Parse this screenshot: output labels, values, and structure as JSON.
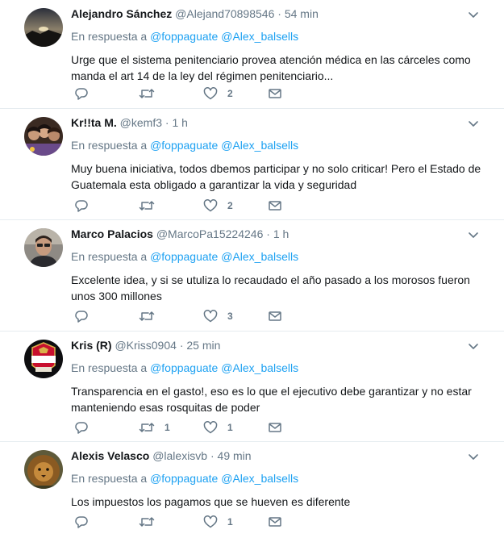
{
  "reply_prefix": "En respuesta a",
  "mentions": [
    "@foppaguate",
    "@Alex_balsells"
  ],
  "tweets": [
    {
      "name": "Alejandro Sánchez",
      "handle": "@Alejand70898546",
      "time": "54 min",
      "text": "Urge que el sistema penitenciario provea atención médica en las cárceles como manda el art 14 de la ley del régimen penitenciario...",
      "replies": "",
      "retweets": "",
      "likes": "2",
      "avatar": "landscape-sunset"
    },
    {
      "name": "Kr!!ta M.",
      "handle": "@kemf3",
      "time": "1 h",
      "text": "Muy buena iniciativa, todos dbemos participar y no solo criticar! Pero el Estado de Guatemala esta obligado a garantizar la vida y seguridad",
      "replies": "",
      "retweets": "",
      "likes": "2",
      "avatar": "group-photo"
    },
    {
      "name": "Marco Palacios",
      "handle": "@MarcoPa15224246",
      "time": "1 h",
      "text": "Excelente idea, y si se utuliza lo recaudado el año pasado a los morosos fueron unos 300 millones",
      "replies": "",
      "retweets": "",
      "likes": "3",
      "avatar": "man-portrait"
    },
    {
      "name": "Kris (R)",
      "handle": "@Kriss0904",
      "time": "25 min",
      "text": "Transparencia en el gasto!, eso es lo que el ejecutivo debe garantizar y no estar manteniendo esas rosquitas de poder",
      "replies": "",
      "retweets": "1",
      "likes": "1",
      "avatar": "stella-artois-logo"
    },
    {
      "name": "Alexis Velasco",
      "handle": "@lalexisvb",
      "time": "49 min",
      "text": "Los impuestos los pagamos que se hueven es diferente",
      "replies": "",
      "retweets": "",
      "likes": "1",
      "avatar": "lion-photo"
    }
  ],
  "colors": {
    "text": "#14171a",
    "muted": "#657786",
    "link": "#1da1f2",
    "divider": "#e6ecf0"
  }
}
